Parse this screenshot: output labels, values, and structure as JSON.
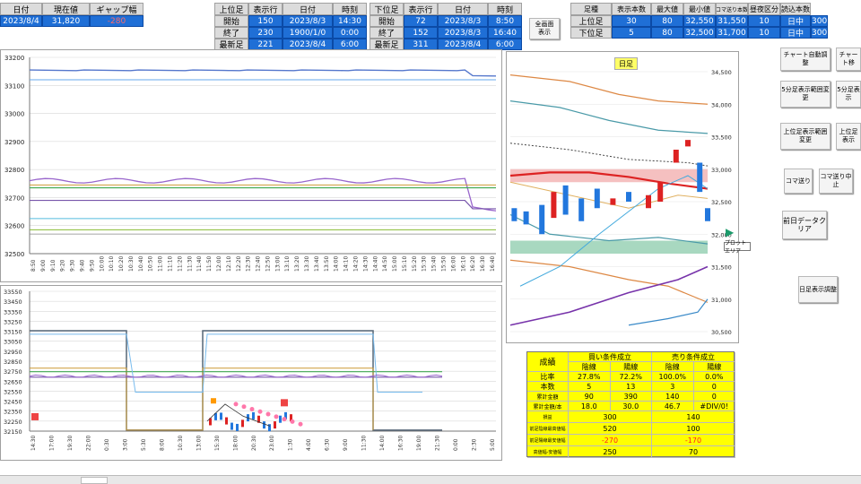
{
  "top_left": {
    "headers": [
      "日付",
      "現在値",
      "ギャップ幅"
    ],
    "values": [
      "2023/8/4",
      "31,820",
      "-280"
    ]
  },
  "upper_leg": {
    "title": "上位足",
    "col_rows": "表示行",
    "col_date": "日付",
    "col_time": "時刻",
    "rows": [
      {
        "label": "開始",
        "rows": "150",
        "date": "2023/8/3",
        "time": "14:30"
      },
      {
        "label": "終了",
        "rows": "230",
        "date": "1900/1/0",
        "time": "0:00"
      },
      {
        "label": "最新足",
        "rows": "221",
        "date": "2023/8/4",
        "time": "6:00"
      }
    ]
  },
  "lower_leg": {
    "title": "下位足",
    "col_rows": "表示行",
    "col_date": "日付",
    "col_time": "時刻",
    "rows": [
      {
        "label": "開始",
        "rows": "72",
        "date": "2023/8/3",
        "time": "8:50"
      },
      {
        "label": "終了",
        "rows": "152",
        "date": "2023/8/3",
        "time": "16:40"
      },
      {
        "label": "最新足",
        "rows": "311",
        "date": "2023/8/4",
        "time": "6:00"
      }
    ]
  },
  "fullscreen_button": "全画面\n表示",
  "summary": {
    "headers": [
      "足種",
      "表示本数",
      "最大値",
      "最小値",
      "コマ送り本数",
      "昼夜区分",
      "読込本数"
    ],
    "rows": [
      {
        "label": "上位足",
        "values": [
          "30",
          "80",
          "32,550",
          "31,550",
          "10",
          "日中",
          "300"
        ]
      },
      {
        "label": "下位足",
        "values": [
          "5",
          "80",
          "32,500",
          "31,700",
          "10",
          "日中",
          "300"
        ]
      }
    ]
  },
  "buttons": {
    "chart_auto": "チャート自動調整",
    "chart_move": "チャート移",
    "lower_range_change": "5分足表示範囲変更",
    "lower_range_show": "5分足表示",
    "upper_range_change": "上位足表示範囲変更",
    "upper_show": "上位足表示",
    "frame_advance": "コマ送り",
    "frame_stop": "コマ送り中止",
    "prev_day_clear": "前日データクリア",
    "daily_adjust": "日足表示調整"
  },
  "daily_chart": {
    "title": "日足",
    "tooltip": "プロット エリア",
    "yticks": [
      "34,500",
      "34,000",
      "33,500",
      "33,000",
      "32,500",
      "32,000",
      "31,500",
      "31,000",
      "30,500"
    ]
  },
  "chart_top": {
    "yticks": [
      "33200",
      "33100",
      "33000",
      "32900",
      "32800",
      "32700",
      "32600",
      "32500"
    ],
    "xticks": [
      "8:50",
      "9:00",
      "9:10",
      "9:20",
      "9:30",
      "9:40",
      "9:50",
      "10:00",
      "10:10",
      "10:20",
      "10:30",
      "10:40",
      "10:50",
      "11:00",
      "11:10",
      "11:20",
      "11:30",
      "11:40",
      "11:50",
      "12:00",
      "12:10",
      "12:20",
      "12:30",
      "12:40",
      "12:50",
      "13:00",
      "13:10",
      "13:20",
      "13:30",
      "13:40",
      "13:50",
      "14:00",
      "14:10",
      "14:20",
      "14:30",
      "14:40",
      "14:50",
      "15:00",
      "15:10",
      "15:20",
      "15:30",
      "15:40",
      "15:50",
      "16:00",
      "16:10",
      "16:20",
      "16:30",
      "16:40"
    ]
  },
  "chart_bottom": {
    "yticks": [
      "33550",
      "33450",
      "33350",
      "33250",
      "33150",
      "33050",
      "32950",
      "32850",
      "32750",
      "32650",
      "32550",
      "32450",
      "32350",
      "32250",
      "32150"
    ],
    "xticks": [
      "14:30",
      "17:00",
      "19:30",
      "22:00",
      "0:30",
      "3:00",
      "5:30",
      "8:00",
      "10:30",
      "13:00",
      "15:30",
      "18:00",
      "20:30",
      "23:00",
      "1:30",
      "4:00",
      "6:30",
      "9:00",
      "11:30",
      "14:00",
      "16:30",
      "19:00",
      "21:30",
      "0:00",
      "2:30",
      "5:00"
    ]
  },
  "stats": {
    "title": "成績",
    "buy_header": "買い条件成立",
    "sell_header": "売り条件成立",
    "sub": [
      "陰線",
      "陽線",
      "陰線",
      "陽線"
    ],
    "rows": [
      {
        "label": "比率",
        "values": [
          "27.8%",
          "72.2%",
          "100.0%",
          "0.0%"
        ]
      },
      {
        "label": "本数",
        "values": [
          "5",
          "13",
          "3",
          "0"
        ]
      },
      {
        "label": "累計金額",
        "values": [
          "90",
          "390",
          "140",
          "0"
        ]
      },
      {
        "label": "累計金額/本",
        "values": [
          "18.0",
          "30.0",
          "46.7",
          "#DIV/0!"
        ]
      }
    ],
    "merged_rows": [
      {
        "label": "損益",
        "buy": "300",
        "sell": "140"
      },
      {
        "label": "前足陰線最高値幅",
        "buy": "520",
        "sell": "100"
      },
      {
        "label": "前足陽線最安値幅",
        "buy": "-270",
        "sell": "-170"
      },
      {
        "label": "高値幅-安値幅",
        "buy": "250",
        "sell": "70"
      }
    ]
  },
  "colors": {
    "header_bg": "#dcdcdc",
    "blue_cell": "#1f6fd6",
    "table_yellow": "#ffff00",
    "negative": "#ff2020"
  }
}
